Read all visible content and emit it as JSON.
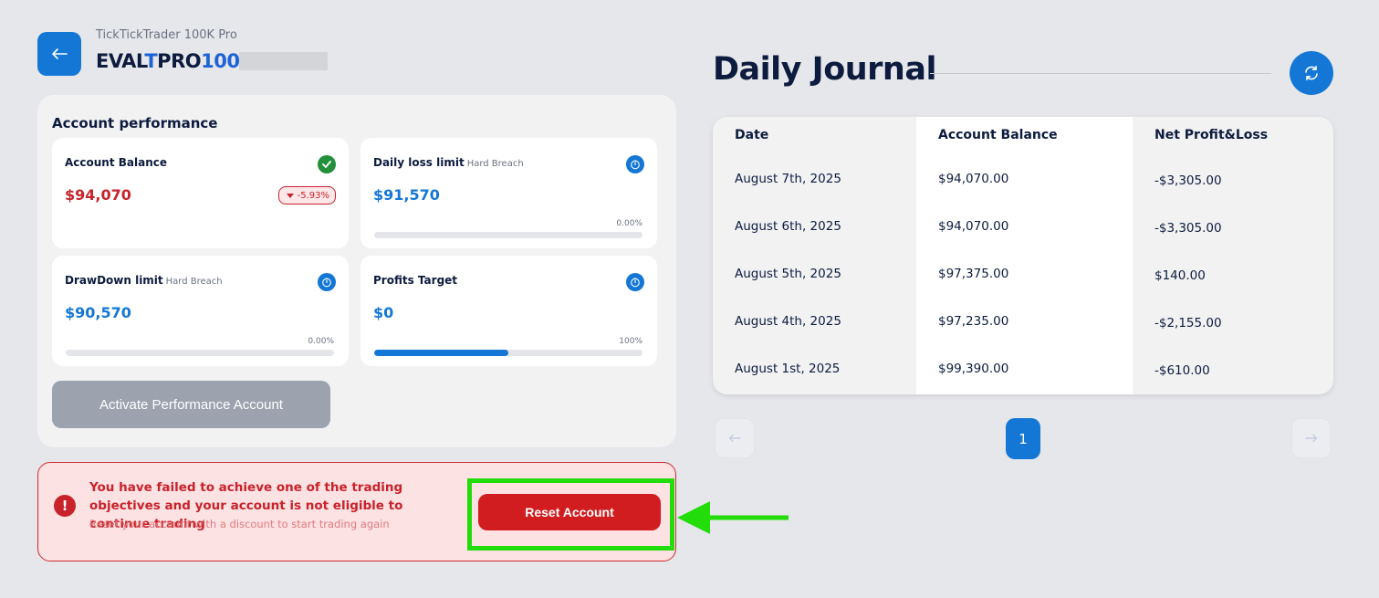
{
  "account": {
    "subtitle": "TickTickTrader 100K Pro",
    "id_prefix": "EVAL",
    "id_accent_t": "T",
    "id_mid": "PRO",
    "id_num": "100"
  },
  "performance": {
    "title": "Account performance",
    "cards": [
      {
        "label": "Account Balance",
        "value": "$94,070",
        "badge": "-5.93%",
        "icon": "check-icon"
      },
      {
        "label": "Daily loss limit",
        "sublabel": "Hard Breach",
        "value": "$91,570",
        "percent_text": "0.00%",
        "progress": 0.0,
        "icon": "timer-icon"
      },
      {
        "label": "DrawDown limit",
        "sublabel": "Hard Breach",
        "value": "$90,570",
        "percent_text": "0.00%",
        "progress": 0.0,
        "icon": "timer-icon"
      },
      {
        "label": "Profits Target",
        "value": "$0",
        "percent_text": "100%",
        "progress": 0.5,
        "icon": "timer-icon"
      }
    ],
    "activate_label": "Activate Performance Account"
  },
  "alert": {
    "title": "You have failed to achieve one of the trading objectives and your account is not eligible to continue trading",
    "subtitle": "Reset your account with a discount to start trading again",
    "button_label": "Reset Account",
    "icon": "exclamation-icon",
    "icon_glyph": "!"
  },
  "journal": {
    "title": "Daily Journal",
    "headers": [
      "Date",
      "Account Balance",
      "Net Profit&Loss"
    ],
    "rows": [
      [
        "August 7th, 2025",
        "$94,070.00",
        "-$3,305.00"
      ],
      [
        "August 6th, 2025",
        "$94,070.00",
        "-$3,305.00"
      ],
      [
        "August 5th, 2025",
        "$97,375.00",
        "$140.00"
      ],
      [
        "August 4th, 2025",
        "$97,235.00",
        "-$2,155.00"
      ],
      [
        "August 1st, 2025",
        "$99,390.00",
        "-$610.00"
      ]
    ],
    "pagination": {
      "current_page": "1"
    }
  },
  "colors": {
    "accent": "#1477d6",
    "danger": "#c8222a",
    "highlight": "#22dd0a"
  }
}
